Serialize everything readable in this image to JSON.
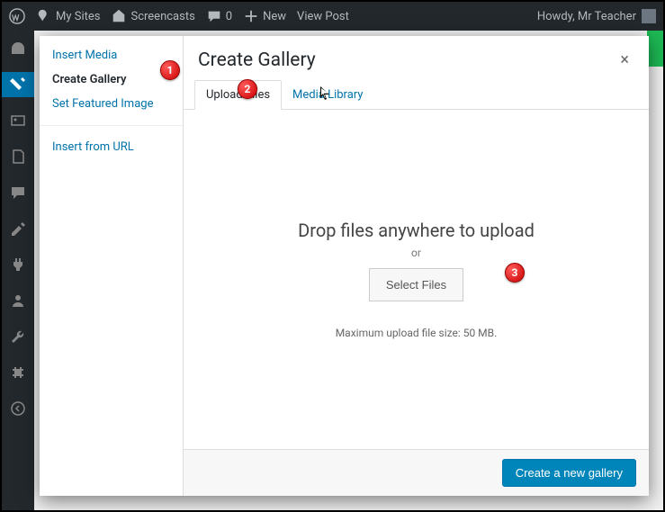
{
  "adminbar": {
    "my_sites": "My Sites",
    "site_name": "Screencasts",
    "comments": "0",
    "new": "New",
    "view_post": "View Post",
    "greeting": "Howdy, Mr Teacher"
  },
  "modal": {
    "title": "Create Gallery",
    "close": "×"
  },
  "sidebar": {
    "insert_media": "Insert Media",
    "create_gallery": "Create Gallery",
    "set_featured": "Set Featured Image",
    "insert_url": "Insert from URL"
  },
  "tabs": {
    "upload": "Upload Files",
    "library": "Media Library"
  },
  "upload": {
    "drop_text": "Drop files anywhere to upload",
    "or": "or",
    "select": "Select Files",
    "max": "Maximum upload file size: 50 MB."
  },
  "footer": {
    "primary": "Create a new gallery"
  },
  "callouts": {
    "c1": "1",
    "c2": "2",
    "c3": "3"
  }
}
